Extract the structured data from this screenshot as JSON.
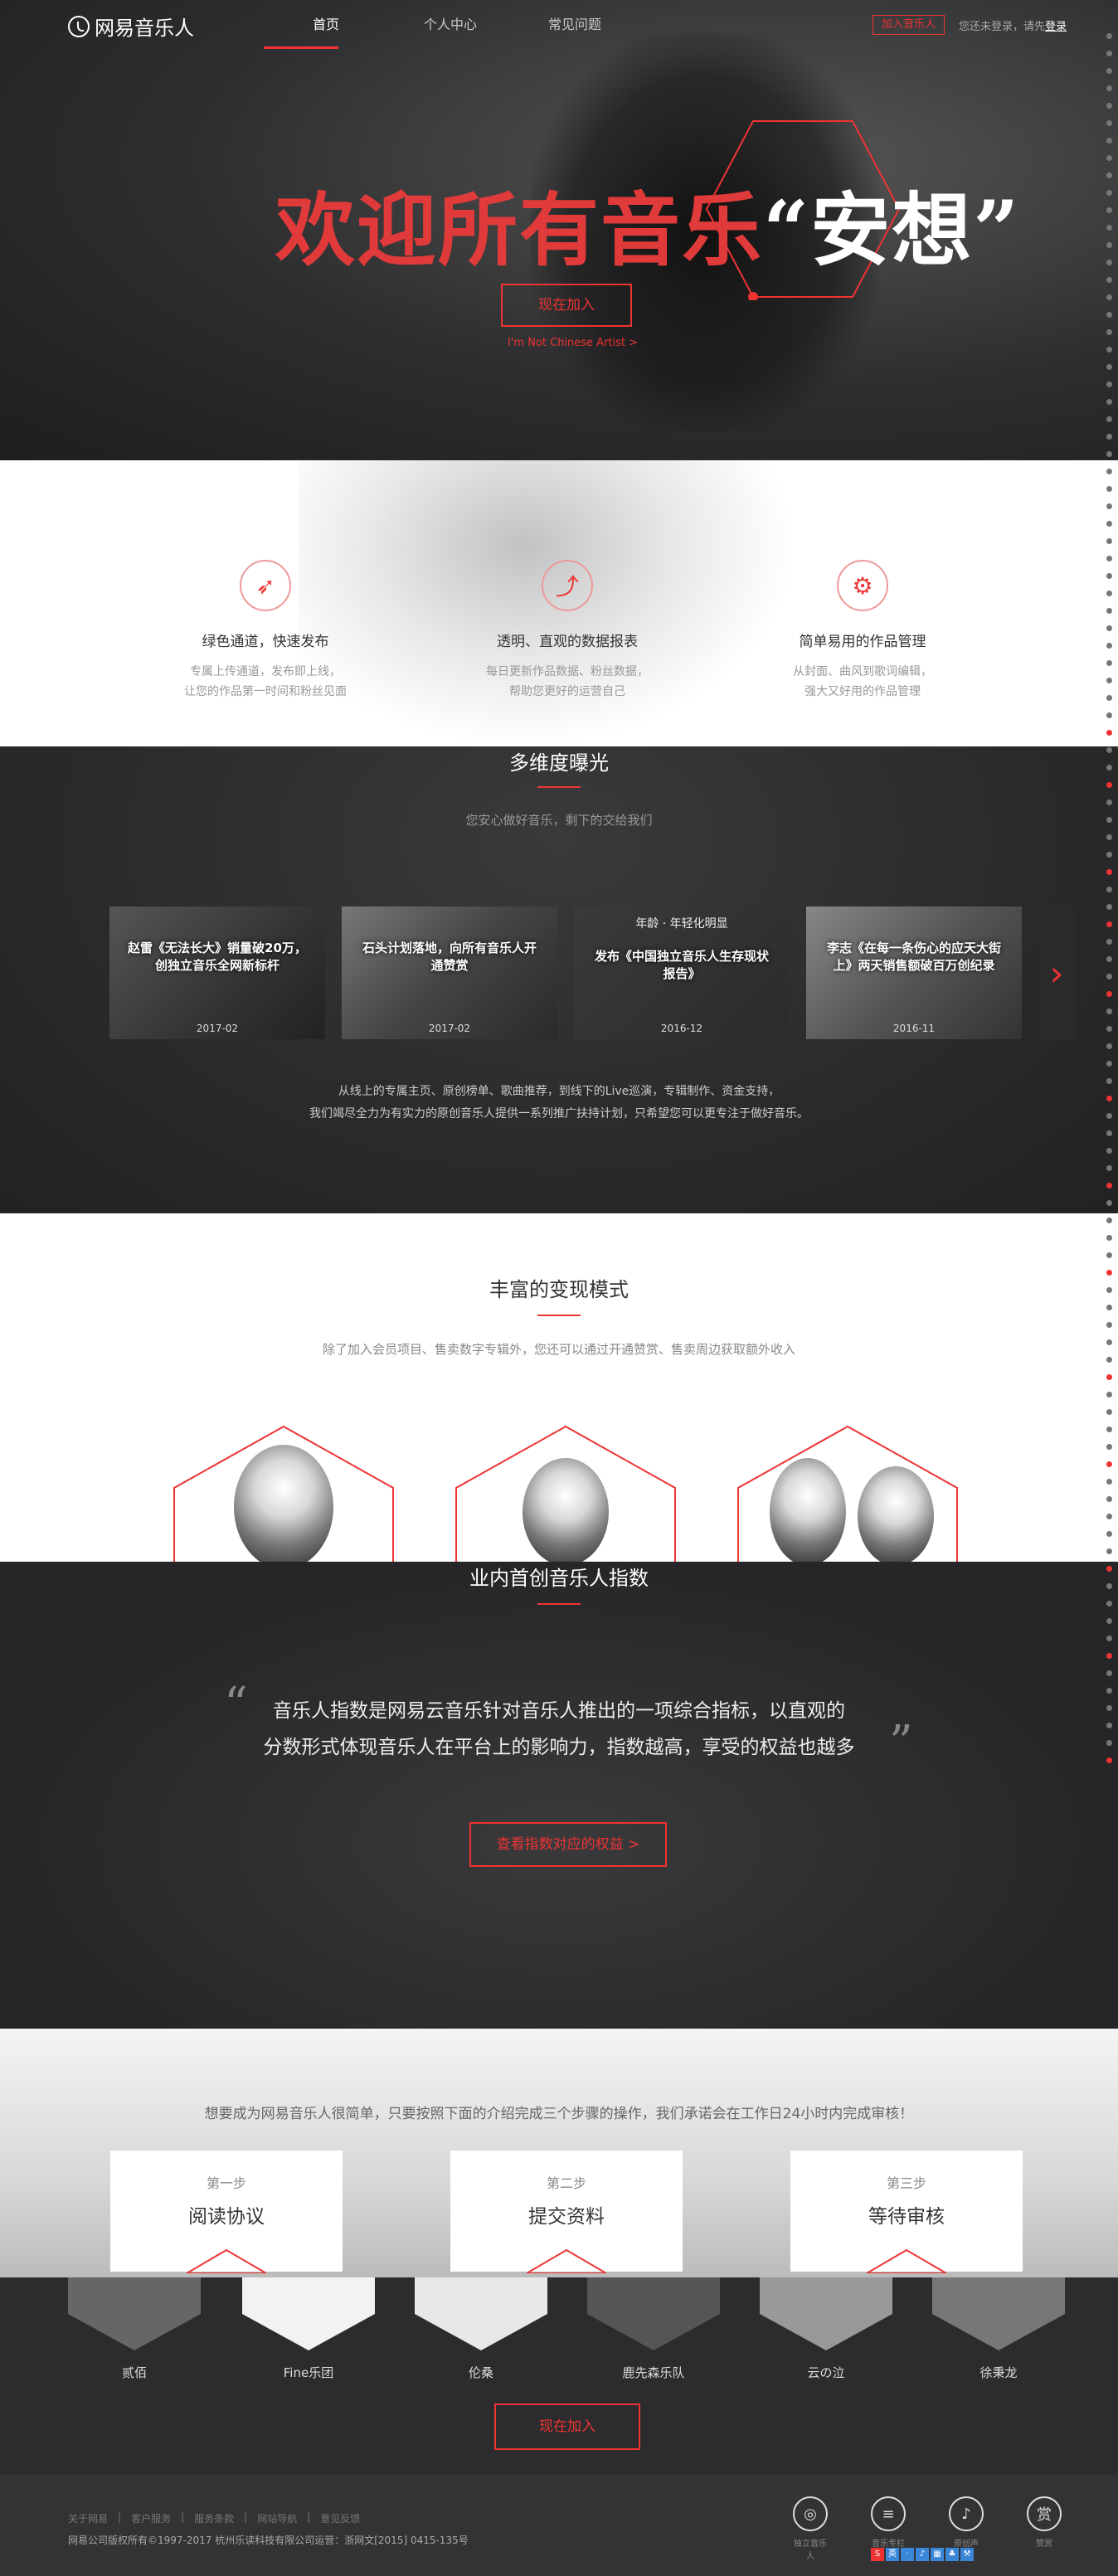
{
  "header": {
    "logo_text": "网易音乐人",
    "nav": [
      "首页",
      "个人中心",
      "常见问题"
    ],
    "join_label": "加入音乐人",
    "login_prompt": "您还未登录，请先",
    "login_link": "登录"
  },
  "hero": {
    "title_red": "欢迎所有音乐",
    "title_white": "“安想”",
    "cta": "现在加入",
    "sub": "I'm Not Chinese Artist >"
  },
  "features": [
    {
      "icon": "rocket-icon",
      "title": "绿色通道，快速发布",
      "desc1": "专属上传通道，发布即上线，",
      "desc2": "让您的作品第一时间和粉丝见面"
    },
    {
      "icon": "chart-icon",
      "title": "透明、直观的数据报表",
      "desc1": "每日更新作品数据、粉丝数据，",
      "desc2": "帮助您更好的运营自己"
    },
    {
      "icon": "sliders-icon",
      "title": "简单易用的作品管理",
      "desc1": "从封面、曲风到歌词编辑，",
      "desc2": "强大又好用的作品管理"
    }
  ],
  "exposure": {
    "title": "多维度曝光",
    "sub": "您安心做好音乐，剩下的交给我们",
    "cards": [
      {
        "text": "赵雷《无法长大》销量破20万，创独立音乐全网新标杆",
        "date": "2017-02"
      },
      {
        "text": "石头计划落地，向所有音乐人开通赞赏",
        "date": "2017-02"
      },
      {
        "text": "发布《中国独立音乐人生存现状报告》",
        "date": "2016-12",
        "top": "年龄 · 年轻化明显"
      },
      {
        "text": "李志《在每一条伤心的应天大街上》两天销售额破百万创纪录",
        "date": "2016-11"
      }
    ],
    "desc1": "从线上的专属主页、原创榜单、歌曲推荐，到线下的Live巡演，专辑制作、资金支持，",
    "desc2": "我们竭尽全力为有实力的原创音乐人提供一系列推广扶持计划，只希望您可以更专注于做好音乐。"
  },
  "monetize": {
    "title": "丰富的变现模式",
    "sub": "除了加入会员项目、售卖数字专辑外，您还可以通过开通赞赏、售卖周边获取额外收入"
  },
  "index": {
    "title": "业内首创音乐人指数",
    "quote1": "音乐人指数是网易云音乐针对音乐人推出的一项综合指标，以直观的",
    "quote2": "分数形式体现音乐人在平台上的影响力，指数越高，享受的权益也越多",
    "btn": "查看指数对应的权益 >"
  },
  "steps": {
    "sub": "想要成为网易音乐人很简单，只要按照下面的介绍完成三个步骤的操作，我们承诺会在工作日24小时内完成审核！",
    "items": [
      {
        "num": "第一步",
        "title": "阅读协议"
      },
      {
        "num": "第二步",
        "title": "提交资料"
      },
      {
        "num": "第三步",
        "title": "等待审核"
      }
    ]
  },
  "artists": {
    "names": [
      "贰佰",
      "Fine乐团",
      "伦桑",
      "鹿先森乐队",
      "云の泣",
      "徐秉龙"
    ],
    "btn": "现在加入"
  },
  "footer": {
    "links": [
      "关于网易",
      "客户服务",
      "服务条款",
      "网站导航",
      "意见反馈"
    ],
    "copyright": "网易公司版权所有©1997-2017   杭州乐读科技有限公司运营：浙网文[2015] 0415-135号",
    "icons": [
      {
        "name": "disc-icon",
        "label": "独立音乐人"
      },
      {
        "name": "list-icon",
        "label": "音乐专栏"
      },
      {
        "name": "mic-icon",
        "label": "原创声"
      },
      {
        "name": "reward-icon",
        "label": "赞赏"
      }
    ]
  },
  "colors": {
    "accent": "#e33333",
    "dark_bg": "#2b2b2d"
  }
}
